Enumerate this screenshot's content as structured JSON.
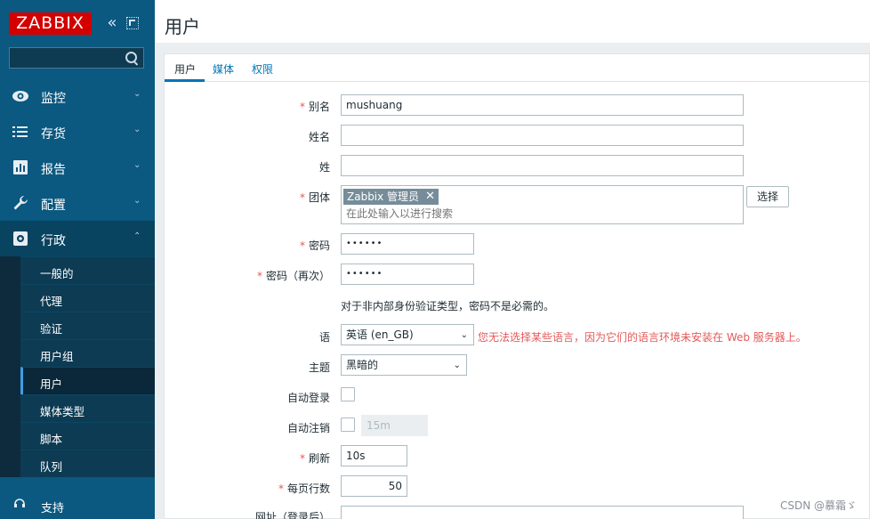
{
  "sidebar": {
    "logo": "ZABBIX",
    "search": {
      "value": "",
      "placeholder": ""
    },
    "menu": [
      {
        "label": "监控",
        "icon": "eye-icon"
      },
      {
        "label": "存货",
        "icon": "list-icon"
      },
      {
        "label": "报告",
        "icon": "bar-chart-icon"
      },
      {
        "label": "配置",
        "icon": "wrench-icon"
      },
      {
        "label": "行政",
        "icon": "gear-icon"
      }
    ],
    "submenu": [
      "一般的",
      "代理",
      "验证",
      "用户组",
      "用户",
      "媒体类型",
      "脚本",
      "队列"
    ],
    "support": "支持"
  },
  "header": {
    "title": "用户"
  },
  "tabs": [
    "用户",
    "媒体",
    "权限"
  ],
  "form": {
    "alias_label": "别名",
    "alias_value": "mushuang",
    "name_label": "姓名",
    "name_value": "",
    "surname_label": "姓",
    "surname_value": "",
    "groups_label": "团体",
    "group_chip": "Zabbix 管理员",
    "groups_placeholder": "在此处输入以进行搜索",
    "select_button": "选择",
    "password_label": "密码",
    "password_value": "••••••",
    "password2_label": "密码（再次）",
    "password2_value": "••••••",
    "password_hint": "对于非内部身份验证类型，密码不是必需的。",
    "language_label": "语",
    "language_value": "英语 (en_GB)",
    "language_warning": "您无法选择某些语言，因为它们的语言环境未安装在 Web 服务器上。",
    "theme_label": "主题",
    "theme_value": "黑暗的",
    "autologin_label": "自动登录",
    "autologout_label": "自动注销",
    "autologout_value": "15m",
    "refresh_label": "刷新",
    "refresh_value": "10s",
    "rows_label": "每页行数",
    "rows_value": "50",
    "url_label": "网址（登录后）",
    "url_value": ""
  },
  "watermark": "CSDN @慕霜ゞ",
  "colors": {
    "sidebar": "#0b5880",
    "logo": "#d40000",
    "link": "#0275b8",
    "required": "#e45959"
  }
}
